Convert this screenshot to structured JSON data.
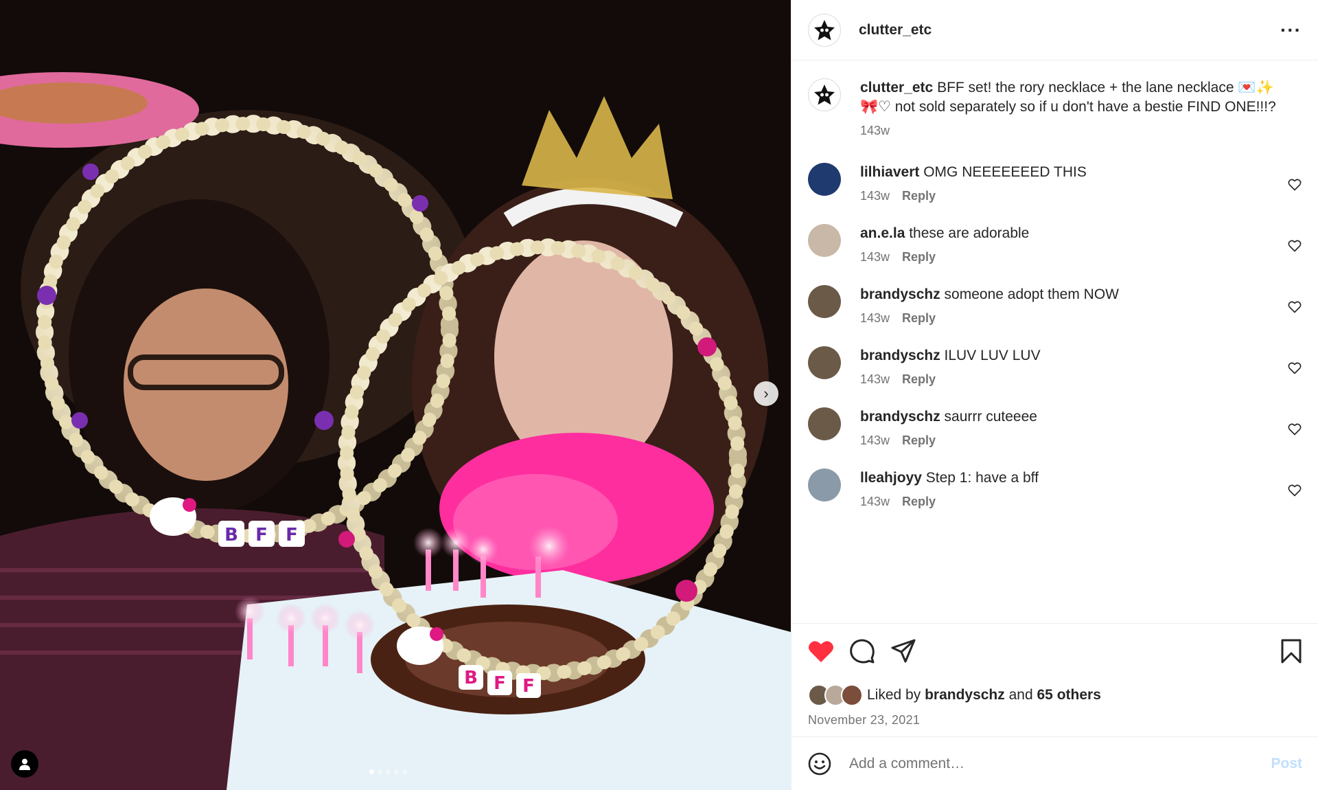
{
  "post": {
    "username": "clutter_etc",
    "more_icon": "more-horizontal-icon",
    "carousel": {
      "total": 5,
      "current": 1
    }
  },
  "caption": {
    "username": "clutter_etc",
    "text": "BFF set! the rory necklace + the lane necklace 💌✨🎀♡ not sold separately so if u don't have a bestie FIND ONE!!!?",
    "time": "143w"
  },
  "comments": [
    {
      "username": "lilhiavert",
      "text": "OMG NEEEEEEED THIS",
      "time": "143w",
      "reply": "Reply",
      "avatar_color": "#1f3a6e"
    },
    {
      "username": "an.e.la",
      "text": "these are adorable",
      "time": "143w",
      "reply": "Reply",
      "avatar_color": "#c9b8a8"
    },
    {
      "username": "brandyschz",
      "text": "someone adopt them NOW",
      "time": "143w",
      "reply": "Reply",
      "avatar_color": "#6b5a48"
    },
    {
      "username": "brandyschz",
      "text": "ILUV LUV LUV",
      "time": "143w",
      "reply": "Reply",
      "avatar_color": "#6b5a48"
    },
    {
      "username": "brandyschz",
      "text": "saurrr cuteeee",
      "time": "143w",
      "reply": "Reply",
      "avatar_color": "#6b5a48"
    },
    {
      "username": "lleahjoyy",
      "text": "Step 1: have a bff",
      "time": "143w",
      "reply": "Reply",
      "avatar_color": "#8a9aa8"
    }
  ],
  "likes": {
    "prefix": "Liked by",
    "user": "brandyschz",
    "and": "and",
    "others": "65 others"
  },
  "date": "November 23, 2021",
  "add_comment": {
    "placeholder": "Add a comment…",
    "post_label": "Post"
  },
  "colors": {
    "like_red": "#ff3040",
    "post_blue": "#c0dffd",
    "muted": "#737373"
  }
}
